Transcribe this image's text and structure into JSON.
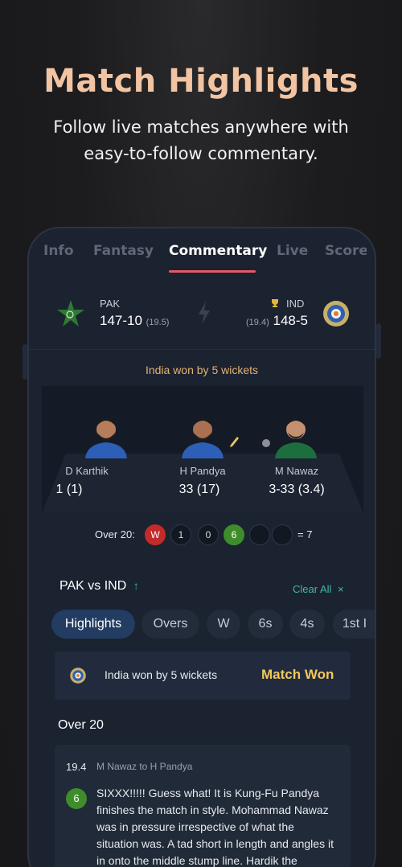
{
  "hero": {
    "title": "Match Highlights",
    "subtitle": "Follow live matches anywhere with easy-to-follow commentary."
  },
  "tabs": [
    {
      "label": "Info",
      "active": false
    },
    {
      "label": "Fantasy",
      "active": false
    },
    {
      "label": "Commentary",
      "active": true
    },
    {
      "label": "Live",
      "active": false
    },
    {
      "label": "Score",
      "active": false
    }
  ],
  "match": {
    "team1": {
      "name": "PAK",
      "score": "147-10",
      "overs": "(19.5)"
    },
    "team2": {
      "name": "IND",
      "score": "148-5",
      "overs": "(19.4)"
    },
    "result": "India won by 5 wickets"
  },
  "players": [
    {
      "name": "D Karthik",
      "stat": "1 (1)"
    },
    {
      "name": "H Pandya",
      "stat": "33 (17)"
    },
    {
      "name": "M Nawaz",
      "stat": "3-33 (3.4)"
    }
  ],
  "over": {
    "label": "Over 20:",
    "balls": [
      "W",
      "1",
      "0",
      "6",
      "",
      ""
    ],
    "total": "= 7"
  },
  "filter": {
    "title": "PAK vs IND",
    "clear": "Clear All",
    "chips": [
      "Highlights",
      "Overs",
      "W",
      "6s",
      "4s",
      "1st I"
    ]
  },
  "won_card": {
    "text": "India won by 5 wickets",
    "badge": "Match Won"
  },
  "over_heading": "Over 20",
  "commentary": {
    "ball": "19.4",
    "players": "M Nawaz to H Pandya",
    "run": "6",
    "text": "SIXXX!!!!! Guess what! It is Kung-Fu Pandya finishes the match in style. Mohammad Nawaz was in pressure irrespective of what the situation was. A tad short in length and angles it in onto the middle stump line. Hardik the"
  },
  "colors": {
    "accent": "#e65a64",
    "title": "#f2c4a2",
    "result": "#e4b272",
    "match_won": "#f0c75a",
    "clear_all": "#3fb9a8"
  }
}
